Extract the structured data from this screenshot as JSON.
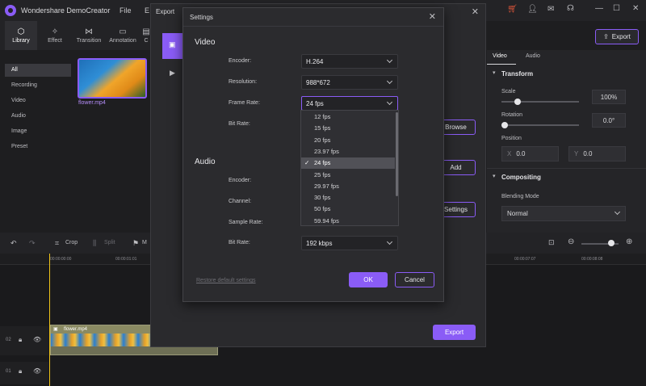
{
  "app": {
    "name": "Wondershare DemoCreator",
    "menu": [
      "File",
      "E"
    ],
    "window_controls": {
      "minimize": "—",
      "maximize": "☐",
      "close": "✕"
    }
  },
  "left_tabs": [
    {
      "label": "Library",
      "icon": "cube-icon"
    },
    {
      "label": "Effect",
      "icon": "wand-icon"
    },
    {
      "label": "Transition",
      "icon": "transition-icon"
    },
    {
      "label": "Annotation",
      "icon": "annotation-icon"
    },
    {
      "label": "C",
      "icon": "caption-icon"
    }
  ],
  "library_sidebar": [
    "All",
    "Recording",
    "Video",
    "Audio",
    "Image",
    "Preset"
  ],
  "media": {
    "name": "flower.mp4"
  },
  "right_panel": {
    "tabs": [
      "Video",
      "Audio"
    ],
    "export_label": "Export",
    "transform": {
      "title": "Transform",
      "scale_label": "Scale",
      "scale_value": "100%",
      "rotation_label": "Rotation",
      "rotation_value": "0.0°",
      "position_label": "Position",
      "x_label": "X",
      "x_value": "0.0",
      "y_label": "Y",
      "y_value": "0.0"
    },
    "compositing": {
      "title": "Compositing",
      "blending_label": "Blending Mode",
      "blending_value": "Normal"
    }
  },
  "toolbar": {
    "crop": "Crop",
    "split": "Split",
    "more": "M"
  },
  "timeline": {
    "times": [
      "00:00:00:00",
      "00:00:01:01",
      "00:00:07:07",
      "00:00:08:08"
    ],
    "tracks": [
      "02",
      "01"
    ],
    "clip_name": "flower.mp4"
  },
  "export_dialog": {
    "title": "Export",
    "browse": "Browse",
    "add": "Add",
    "settings": "Settings",
    "export_btn": "Export"
  },
  "settings_dialog": {
    "title": "Settings",
    "video_heading": "Video",
    "audio_heading": "Audio",
    "video_fields": [
      {
        "label": "Encoder:",
        "value": "H.264"
      },
      {
        "label": "Resolution:",
        "value": "988*672"
      },
      {
        "label": "Frame Rate:",
        "value": "24 fps"
      },
      {
        "label": "Bit Rate:",
        "value": ""
      }
    ],
    "audio_fields": [
      {
        "label": "Encoder:",
        "value": ""
      },
      {
        "label": "Channel:",
        "value": ""
      },
      {
        "label": "Sample Rate:",
        "value": ""
      },
      {
        "label": "Bit Rate:",
        "value": "192 kbps"
      }
    ],
    "frame_rate_options": [
      "12 fps",
      "15 fps",
      "20 fps",
      "23.97 fps",
      "24 fps",
      "25 fps",
      "29.97 fps",
      "30 fps",
      "50 fps",
      "59.94 fps"
    ],
    "frame_rate_selected": "24 fps",
    "restore": "Restore default settings",
    "ok": "OK",
    "cancel": "Cancel"
  },
  "colors": {
    "accent": "#8a5cf6",
    "playhead": "#f0c419"
  }
}
